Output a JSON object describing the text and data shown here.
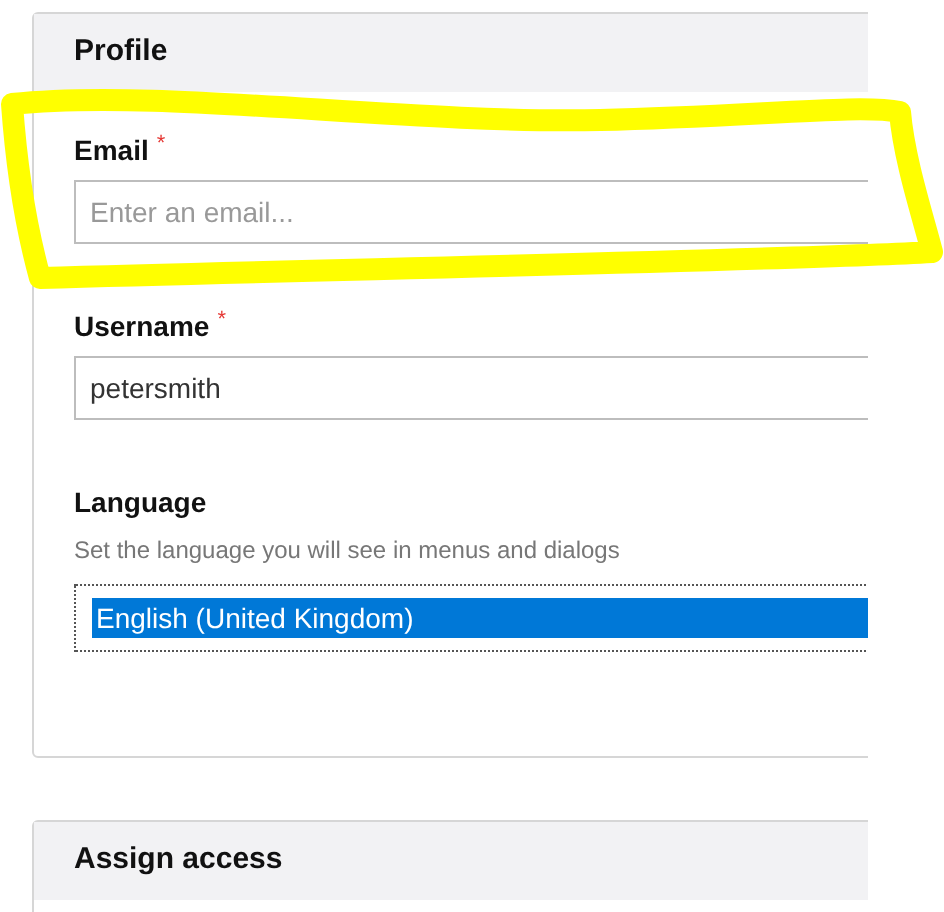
{
  "panels": [
    {
      "title": "Profile",
      "fields": [
        {
          "kind": "text",
          "label": "Email",
          "required_mark": "*",
          "placeholder": "Enter an email..."
        },
        {
          "kind": "text",
          "label": "Username",
          "required_mark": "*",
          "value": "petersmith"
        },
        {
          "kind": "listbox",
          "label": "Language",
          "help": "Set the language you will see in menus and dialogs",
          "options": [
            {
              "label": "English (United Kingdom)",
              "selected": true
            }
          ]
        }
      ]
    },
    {
      "title": "Assign access"
    }
  ]
}
